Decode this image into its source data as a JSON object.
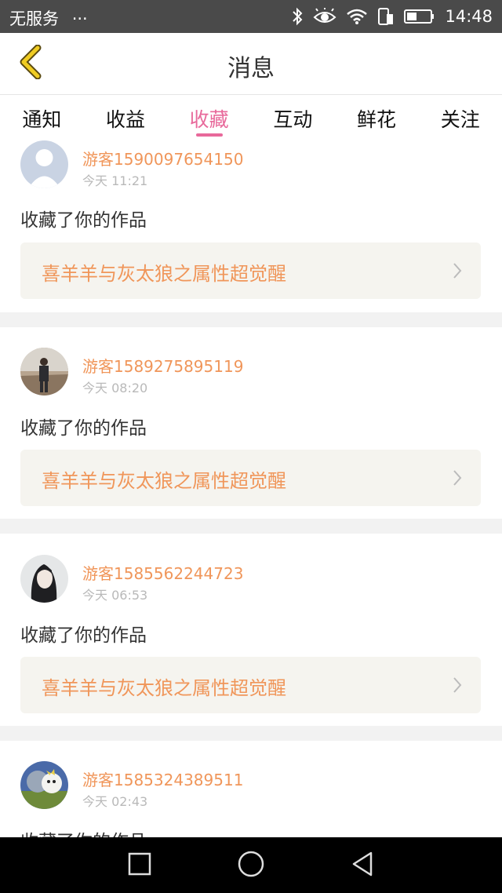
{
  "status_bar": {
    "carrier": "无服务",
    "dots": "···",
    "time": "14:48"
  },
  "header": {
    "title": "消息"
  },
  "tabs": [
    {
      "label": "通知"
    },
    {
      "label": "收益"
    },
    {
      "label": "收藏"
    },
    {
      "label": "互动"
    },
    {
      "label": "鲜花"
    },
    {
      "label": "关注"
    }
  ],
  "active_tab": "收藏",
  "messages": [
    {
      "user": "游客1590097654150",
      "time": "今天 11:21",
      "action": "收藏了你的作品",
      "work": "喜羊羊与灰太狼之属性超觉醒"
    },
    {
      "user": "游客1589275895119",
      "time": "今天 08:20",
      "action": "收藏了你的作品",
      "work": "喜羊羊与灰太狼之属性超觉醒"
    },
    {
      "user": "游客1585562244723",
      "time": "今天 06:53",
      "action": "收藏了你的作品",
      "work": "喜羊羊与灰太狼之属性超觉醒"
    },
    {
      "user": "游客1585324389511",
      "time": "今天 02:43",
      "action": "收藏了你的作品",
      "work": ""
    }
  ],
  "colors": {
    "accent": "#e8699b",
    "username": "#f0965a",
    "back_arrow": "#e8c21e"
  },
  "icons": [
    "back-arrow-icon",
    "bluetooth-icon",
    "eye-icon",
    "wifi-icon",
    "sim-icon",
    "battery-icon",
    "chevron-right-icon",
    "recent-apps-icon",
    "home-icon",
    "back-icon"
  ]
}
